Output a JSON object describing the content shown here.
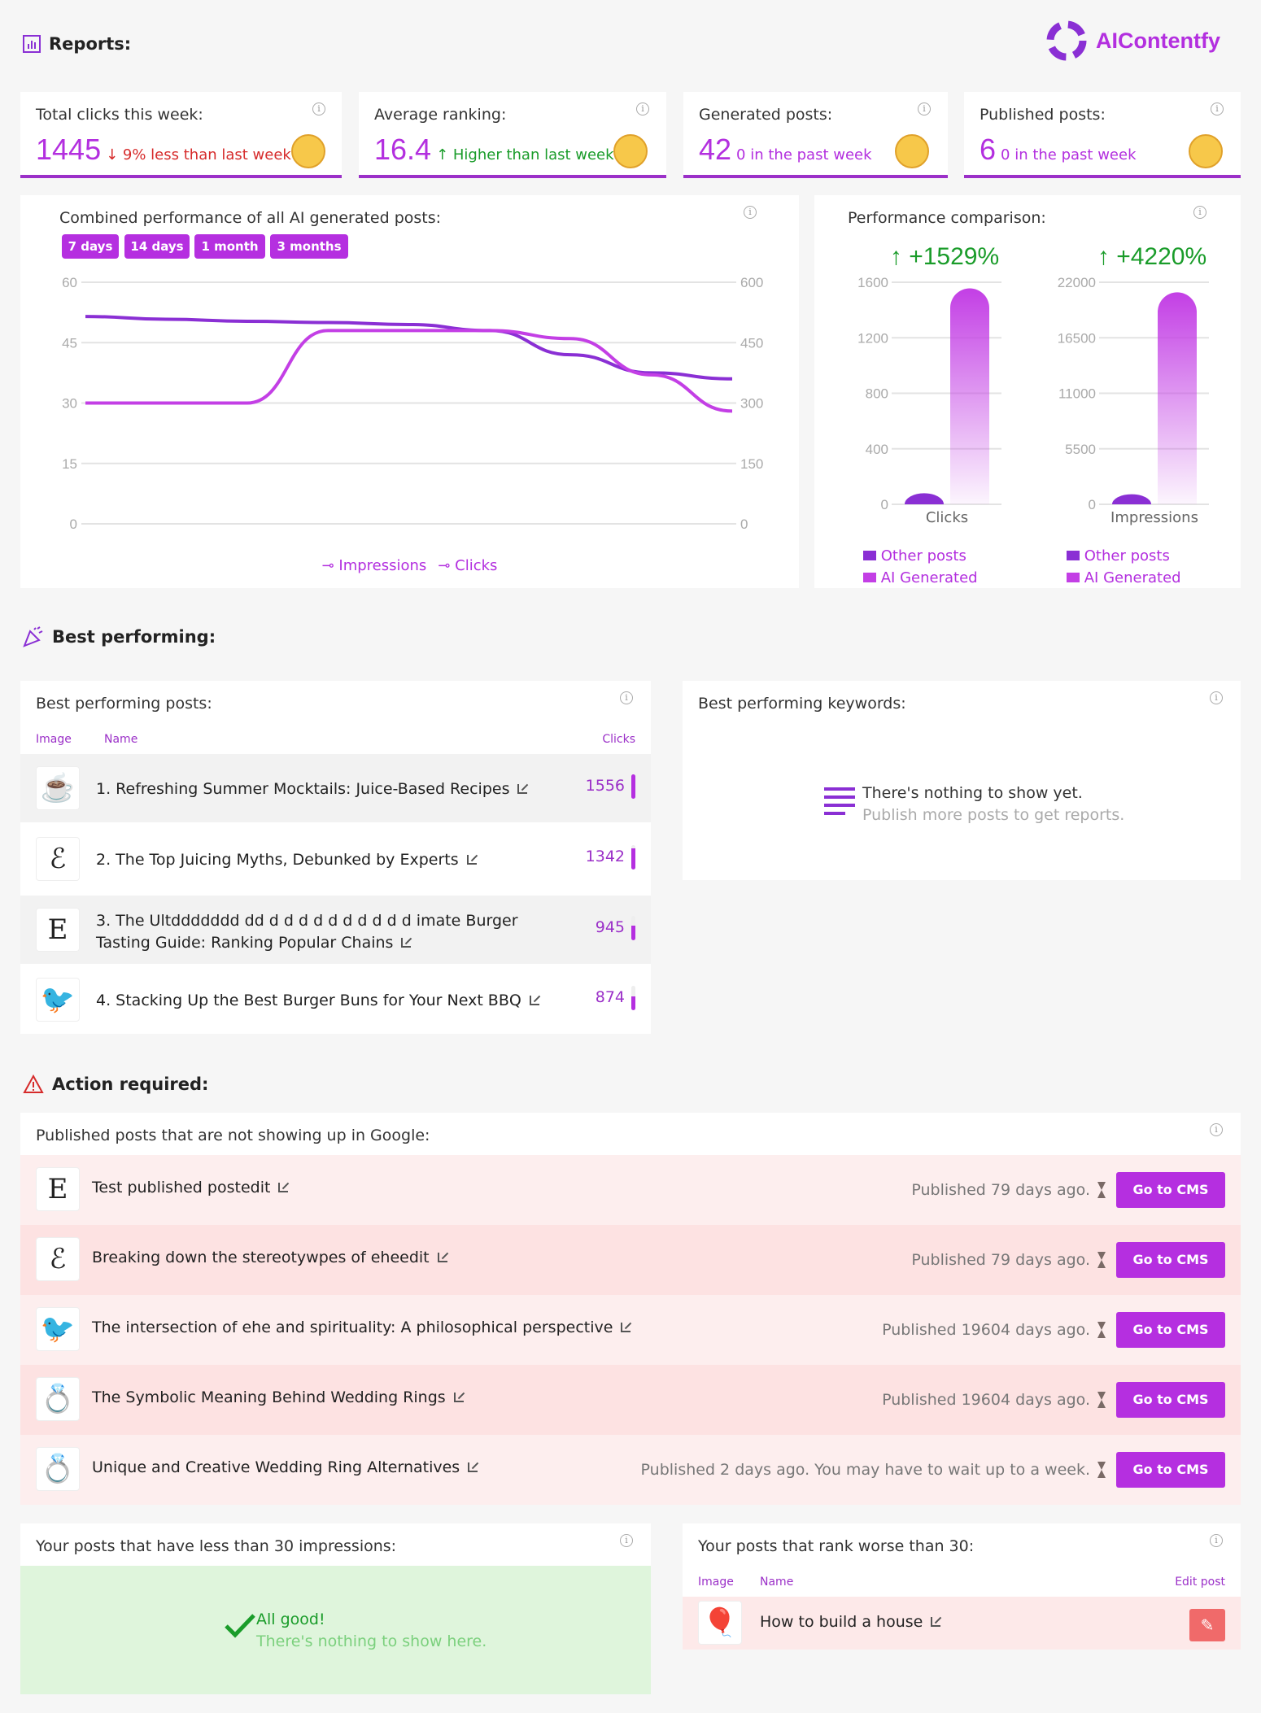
{
  "brand": {
    "name": "AIContentfy",
    "color": "#b32fdf"
  },
  "reports": {
    "title": "Reports:"
  },
  "stats": [
    {
      "label": "Total clicks this week:",
      "value": "1445",
      "change": "↓ 9% less than last week",
      "change_color": "#d62b2b"
    },
    {
      "label": "Average ranking:",
      "value": "16.4",
      "change": "↑ Higher than last week",
      "change_color": "#1a9c2a"
    },
    {
      "label": "Generated posts:",
      "value": "42",
      "change": "0 in the past week",
      "change_color": "#b32fdf"
    },
    {
      "label": "Published posts:",
      "value": "6",
      "change": "0 in the past week",
      "change_color": "#b32fdf"
    }
  ],
  "combined": {
    "title": "Combined performance of all AI generated posts:",
    "ranges": [
      "7 days",
      "14 days",
      "1 month",
      "3 months"
    ],
    "legend": [
      "Impressions",
      "Clicks"
    ]
  },
  "chart_data": [
    {
      "type": "line",
      "title": "Combined performance of all AI generated posts:",
      "left_ticks": [
        "60",
        "45",
        "30",
        "15",
        "0"
      ],
      "right_ticks": [
        "600",
        "450",
        "300",
        "150",
        "0"
      ],
      "ylim_left": [
        0,
        60
      ],
      "ylim_right": [
        0,
        600
      ],
      "grid": true,
      "legend_position": "bottom",
      "series": [
        {
          "name": "Impressions",
          "axis": "right",
          "color": "#8a2fd4",
          "values": [
            515,
            508,
            503,
            500,
            495,
            480,
            420,
            375,
            360
          ]
        },
        {
          "name": "Clicks",
          "axis": "left",
          "color": "#c33fe5",
          "values": [
            30,
            30,
            30,
            48,
            48,
            48,
            46,
            37,
            28
          ]
        }
      ]
    },
    {
      "type": "bar",
      "title": "Performance comparison:",
      "category": "Clicks",
      "change": "↑ +1529%",
      "ticks": [
        "1600",
        "1200",
        "800",
        "400",
        "0"
      ],
      "ylim": [
        0,
        1600
      ],
      "series": [
        {
          "name": "Other posts",
          "values": [
            80
          ]
        },
        {
          "name": "AI Generated",
          "values": [
            1556
          ]
        }
      ]
    },
    {
      "type": "bar",
      "category": "Impressions",
      "change": "↑ +4220%",
      "ticks": [
        "22000",
        "16500",
        "11000",
        "5500",
        "0"
      ],
      "ylim": [
        0,
        22000
      ],
      "series": [
        {
          "name": "Other posts",
          "values": [
            1000
          ]
        },
        {
          "name": "AI Generated",
          "values": [
            21000
          ]
        }
      ]
    }
  ],
  "comparison": {
    "title": "Performance comparison:",
    "cats": [
      "Clicks",
      "Impressions"
    ],
    "changes": [
      "↑ +1529%",
      "↑ +4220%"
    ],
    "legend": [
      "Other posts",
      "AI Generated"
    ]
  },
  "best": {
    "title": "Best performing:",
    "posts_title": "Best performing posts:",
    "cols": [
      "Image",
      "Name",
      "Clicks"
    ],
    "posts": [
      {
        "name": "1. Refreshing Summer Mocktails: Juice-Based Recipes",
        "clicks": "1556",
        "frac": 1.0,
        "icon": "coffee-cup-icon",
        "glyph": "☕"
      },
      {
        "name": "2. The Top Juicing Myths, Debunked by Experts",
        "clicks": "1342",
        "frac": 0.86,
        "icon": "letter-e-icon",
        "glyph": "ℰ"
      },
      {
        "name": "3. The Ultddddddd dd d d d d d d d d d d imate Burger Tasting Guide: Ranking Popular Chains",
        "clicks": "945",
        "frac": 0.6,
        "icon": "letter-e-icon",
        "glyph": "E"
      },
      {
        "name": "4. Stacking Up the Best Burger Buns for Your Next BBQ",
        "clicks": "874",
        "frac": 0.56,
        "icon": "bird-icon",
        "glyph": "🐦"
      }
    ],
    "keywords_title": "Best performing keywords:",
    "empty_main": "There's nothing to show yet.",
    "empty_sub": "Publish more posts to get reports."
  },
  "action": {
    "title": "Action required:",
    "google_title": "Published posts that are not showing up in Google:",
    "cms_label": "Go to CMS",
    "rows": [
      {
        "name": "Test published postedit",
        "status": "Published 79 days ago.",
        "glyph": "E"
      },
      {
        "name": "Breaking down the stereotywpes of eheedit",
        "status": "Published 79 days ago.",
        "glyph": "ℰ"
      },
      {
        "name": "The intersection of ehe and spirituality: A philosophical perspective",
        "status": "Published 19604 days ago.",
        "glyph": "🐦"
      },
      {
        "name": "The Symbolic Meaning Behind Wedding Rings",
        "status": "Published 19604 days ago.",
        "glyph": "💍"
      },
      {
        "name": "Unique and Creative Wedding Ring Alternatives",
        "status": "Published 2 days ago. You may have to wait up to a week.",
        "glyph": "💍"
      }
    ],
    "low_title": "Your posts that have less than 30 impressions:",
    "low_main": "All good!",
    "low_sub": "There's nothing to show here.",
    "rank_title": "Your posts that rank worse than 30:",
    "rank_cols": [
      "Image",
      "Name",
      "Edit post"
    ],
    "rank_row": {
      "name": "How to build a house",
      "glyph": "🎈"
    }
  }
}
